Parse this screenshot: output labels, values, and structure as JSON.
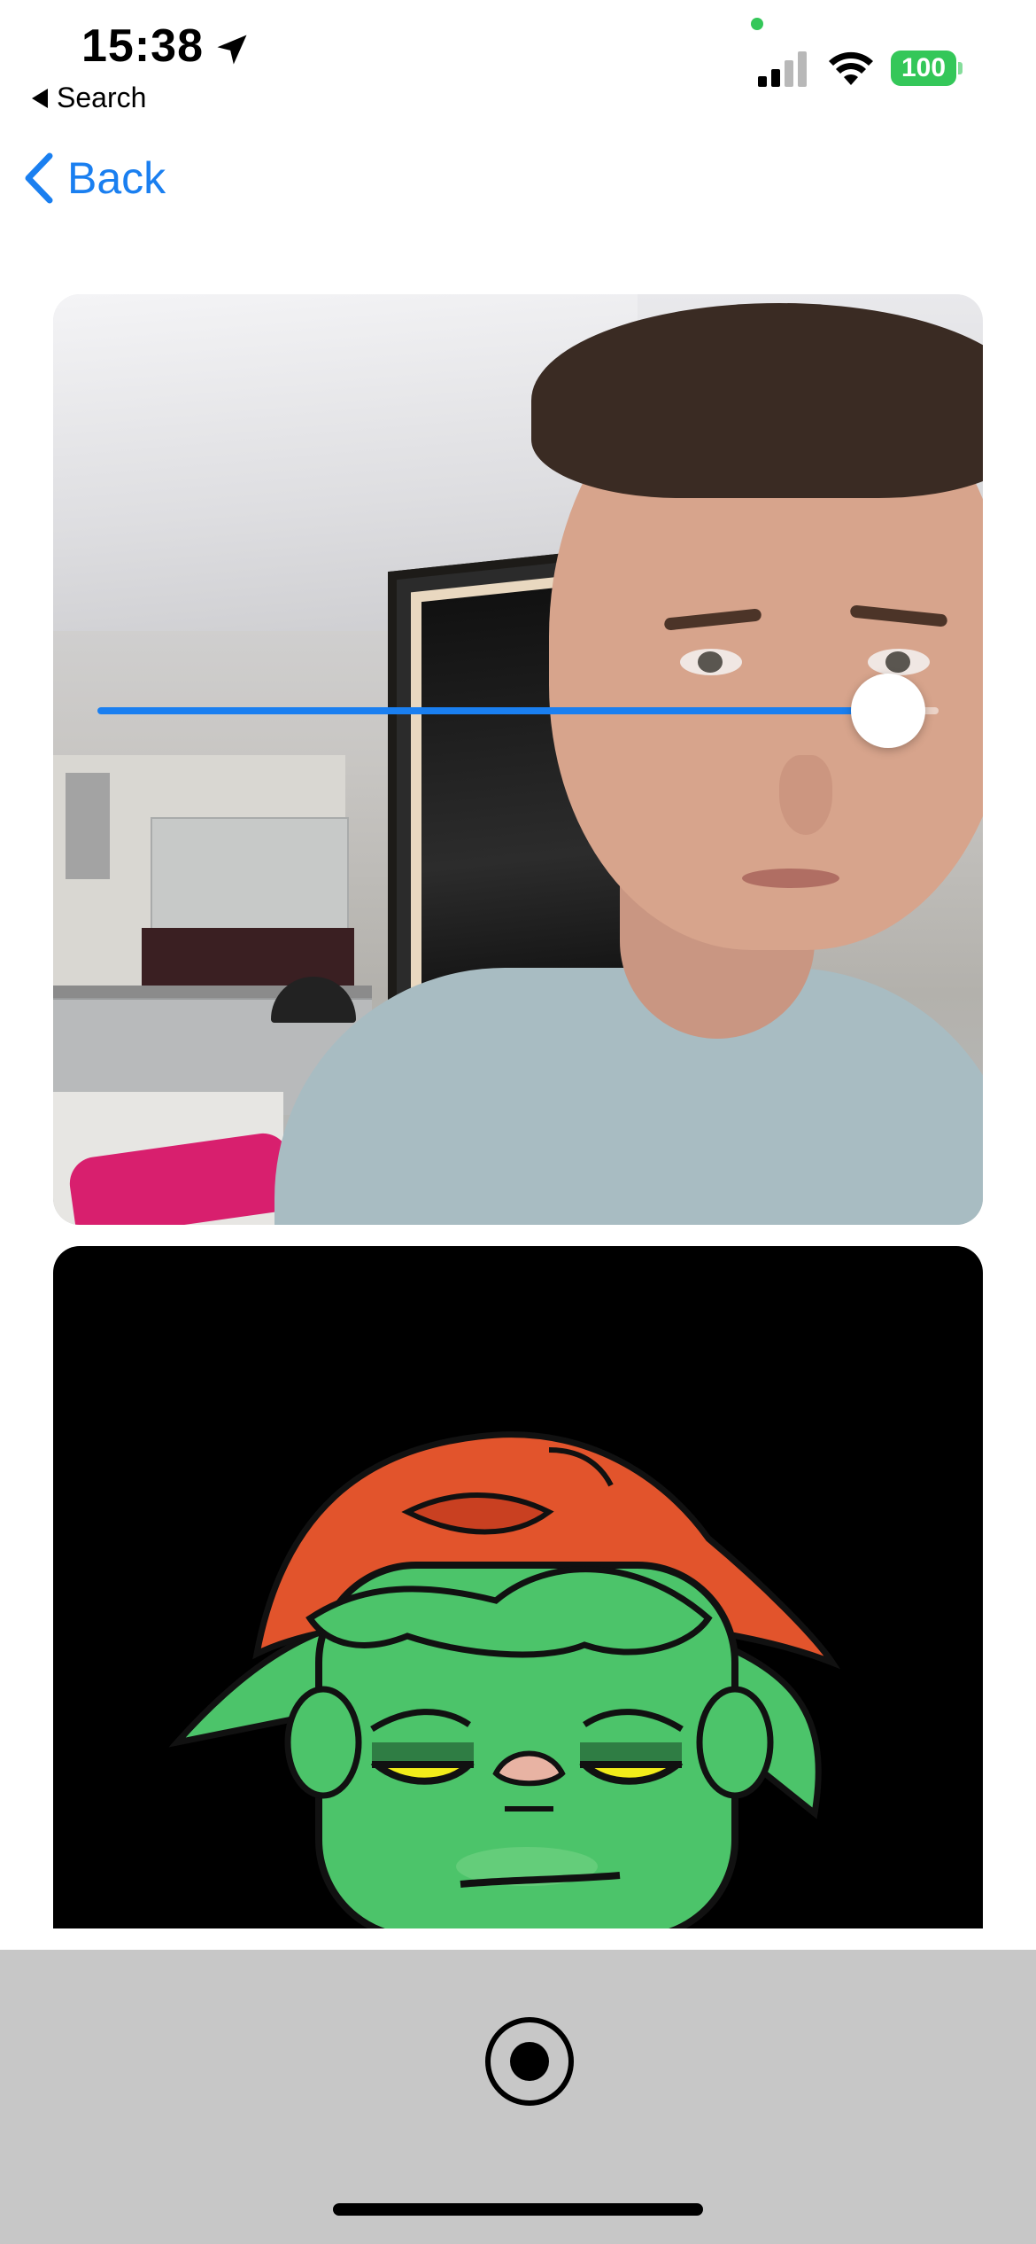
{
  "status_bar": {
    "time": "15:38",
    "back_app": "Search",
    "battery": "100"
  },
  "nav": {
    "back_label": "Back"
  },
  "camera": {
    "slider_value": 0.94,
    "accent_color": "#1a7ff0"
  },
  "avatar": {
    "background": "#000000",
    "skin_color": "#4cc46a",
    "hair_color": "#e2542c",
    "eye_color": "#f2ec1a"
  },
  "controls": {
    "record_icon": "record-icon"
  }
}
